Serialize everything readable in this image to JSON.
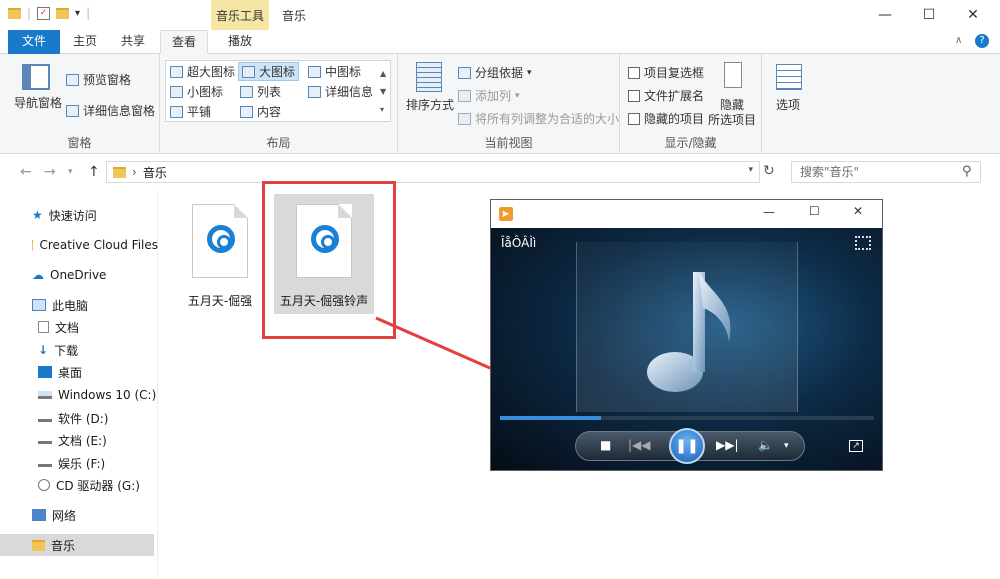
{
  "window": {
    "title": "音乐",
    "context_tab": "音乐工具",
    "controls": {
      "minimize": "—",
      "maximize": "☐",
      "close": "✕"
    }
  },
  "tabs": [
    {
      "label": "文件"
    },
    {
      "label": "主页"
    },
    {
      "label": "共享"
    },
    {
      "label": "查看"
    },
    {
      "label": "播放"
    }
  ],
  "ribbon": {
    "panes": {
      "group_label": "窗格",
      "nav_pane": "导航窗格",
      "preview_pane": "预览窗格",
      "details_pane": "详细信息窗格"
    },
    "layout": {
      "group_label": "布局",
      "items": [
        "超大图标",
        "大图标",
        "中图标",
        "小图标",
        "列表",
        "详细信息",
        "平铺",
        "内容"
      ],
      "selected": "大图标"
    },
    "current_view": {
      "group_label": "当前视图",
      "sort_by": "排序方式",
      "group_by": "分组依据",
      "add_column": "添加列",
      "fit_columns": "将所有列调整为合适的大小"
    },
    "show_hide": {
      "group_label": "显示/隐藏",
      "item_checkboxes": "项目复选框",
      "file_extensions": "文件扩展名",
      "hidden_items": "隐藏的项目",
      "hide_selected_1": "隐藏",
      "hide_selected_2": "所选项目"
    },
    "options": {
      "label": "选项"
    }
  },
  "address": {
    "path": "音乐",
    "search_placeholder": "搜索\"音乐\""
  },
  "sidebar": {
    "items": [
      {
        "label": "快速访问"
      },
      {
        "label": "Creative Cloud Files"
      },
      {
        "label": "OneDrive"
      },
      {
        "label": "此电脑"
      },
      {
        "label": "文档"
      },
      {
        "label": "下载"
      },
      {
        "label": "桌面"
      },
      {
        "label": "Windows 10 (C:)"
      },
      {
        "label": "软件 (D:)"
      },
      {
        "label": "文档 (E:)"
      },
      {
        "label": "娱乐 (F:)"
      },
      {
        "label": "CD 驱动器 (G:)"
      },
      {
        "label": "网络"
      },
      {
        "label": "音乐"
      }
    ]
  },
  "files": [
    {
      "name": "五月天-倔强"
    },
    {
      "name": "五月天-倔强铃声"
    }
  ],
  "player": {
    "now_playing": "ÎåÔÂÌì",
    "seek_fraction": 0.27,
    "colors": {
      "accent": "#3a8ddd",
      "highlight": "#e43f3f"
    }
  }
}
